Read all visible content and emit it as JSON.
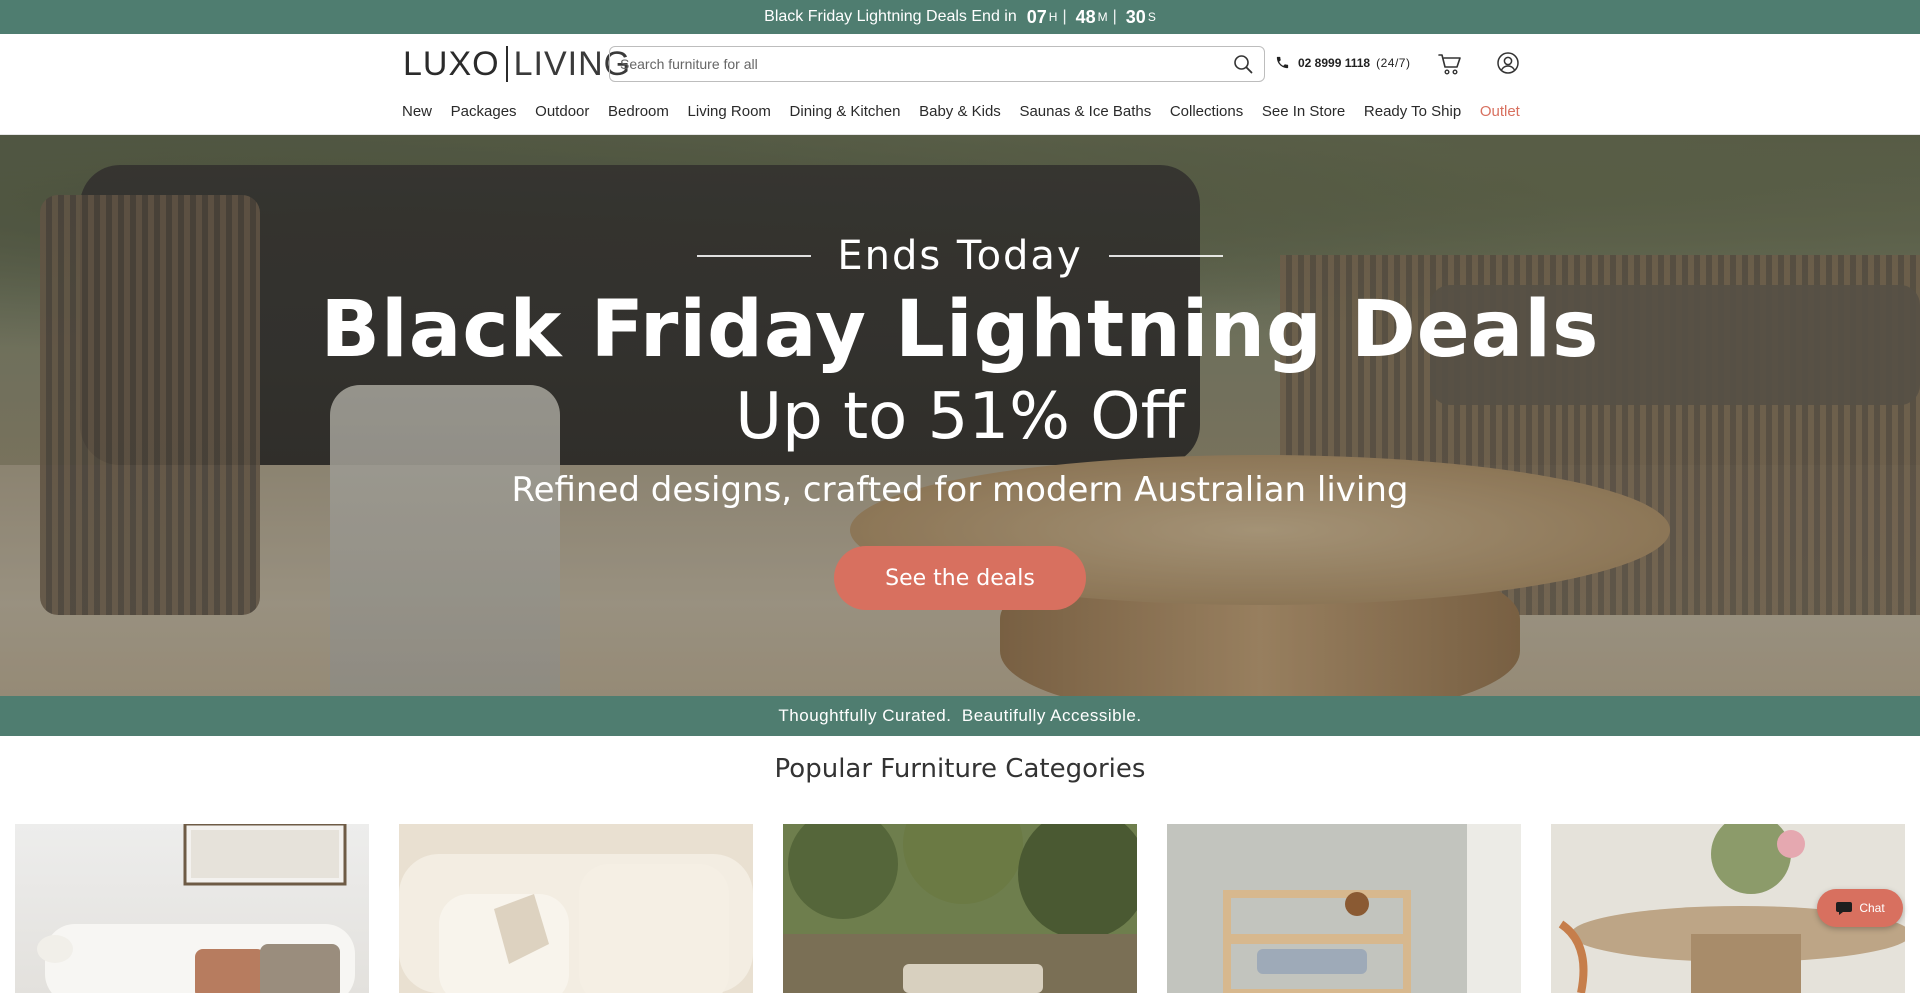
{
  "announcement": {
    "message": "Black Friday Lightning Deals End in",
    "hours": "07",
    "hours_unit": "H",
    "minutes": "48",
    "minutes_unit": "M",
    "seconds": "30",
    "seconds_unit": "S",
    "separator": "|",
    "background_color": "#4f7d70"
  },
  "header": {
    "logo_left": "LUXO",
    "logo_right": "LIVING",
    "search_placeholder": "Search furniture for all",
    "phone": "02 8999 1118",
    "phone_hours": "(24/7)",
    "icons": [
      "search-icon",
      "phone-icon",
      "cart-icon",
      "user-icon"
    ]
  },
  "nav": {
    "items": [
      "New",
      "Packages",
      "Outdoor",
      "Bedroom",
      "Living Room",
      "Dining & Kitchen",
      "Baby & Kids",
      "Saunas & Ice Baths",
      "Collections",
      "See In Store",
      "Ready To Ship",
      "Outlet"
    ],
    "highlight_color": "#d8705f"
  },
  "hero": {
    "eyebrow": "Ends Today",
    "title": "Black Friday Lightning Deals",
    "subtitle": "Up to 51% Off",
    "tagline": "Refined designs, crafted for modern Australian living",
    "cta_label": "See the deals",
    "cta_color": "#d8705f"
  },
  "strip": {
    "text": "Thoughtfully Curated.  Beautifully Accessible."
  },
  "categories": {
    "title": "Popular Furniture Categories"
  },
  "chat": {
    "label": "Chat"
  }
}
